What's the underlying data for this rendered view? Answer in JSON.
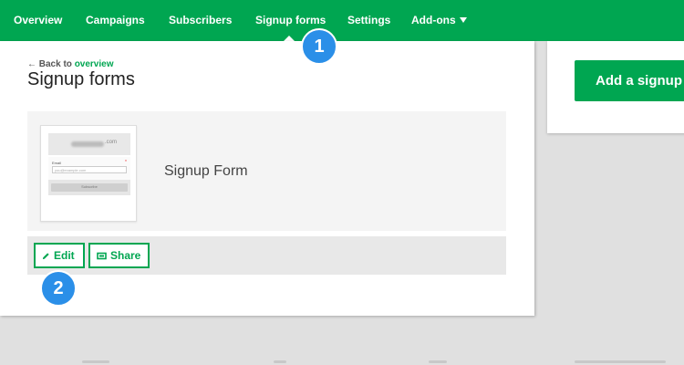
{
  "nav": {
    "items": [
      {
        "label": "Overview"
      },
      {
        "label": "Campaigns"
      },
      {
        "label": "Subscribers"
      },
      {
        "label": "Signup forms"
      },
      {
        "label": "Settings"
      },
      {
        "label": "Add-ons"
      }
    ]
  },
  "breadcrumb": {
    "prefix": "← Back to",
    "link": "overview"
  },
  "page": {
    "title": "Signup forms"
  },
  "form": {
    "name": "Signup Form",
    "thumbnail": {
      "domain": ".com",
      "field_label": "Email",
      "field_required": "*",
      "field_placeholder": "you@example.com",
      "button_label": "Subscribe"
    }
  },
  "actions": {
    "edit_label": "Edit",
    "share_label": "Share"
  },
  "side": {
    "add_button_label": "Add a signup form"
  },
  "badges": {
    "one": "1",
    "two": "2"
  },
  "colors": {
    "brand_green": "#00a651",
    "badge_blue": "#2b8fe8"
  }
}
